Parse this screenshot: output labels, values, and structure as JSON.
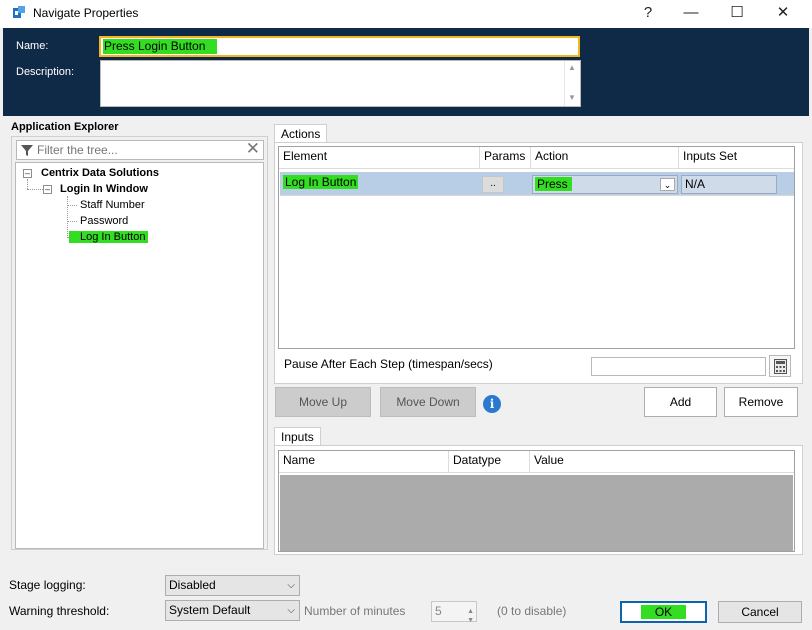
{
  "window": {
    "title": "Navigate Properties",
    "help_glyph": "?",
    "minimize_glyph": "—",
    "maximize_glyph": "☐",
    "close_glyph": "✕"
  },
  "header": {
    "name_label": "Name:",
    "name_value": "Press Login Button",
    "description_label": "Description:",
    "description_value": ""
  },
  "explorer": {
    "title": "Application Explorer",
    "filter_placeholder": "Filter the tree...",
    "tree": {
      "root": "Centrix Data Solutions",
      "window": "Login In Window",
      "items": [
        "Staff Number",
        "Password",
        "Log In Button"
      ]
    }
  },
  "actions": {
    "tab_label": "Actions",
    "columns": [
      "Element",
      "Params",
      "Action",
      "Inputs Set"
    ],
    "rows": [
      {
        "element": "Log In Button",
        "params": "..",
        "action": "Press",
        "inputs_set": "N/A"
      }
    ],
    "pause_label": "Pause After Each Step (timespan/secs)",
    "pause_value": "",
    "buttons": {
      "move_up": "Move Up",
      "move_down": "Move Down",
      "add": "Add",
      "remove": "Remove"
    }
  },
  "inputs": {
    "tab_label": "Inputs",
    "columns": [
      "Name",
      "Datatype",
      "Value"
    ]
  },
  "footer": {
    "stage_logging_label": "Stage logging:",
    "stage_logging_value": "Disabled",
    "warning_label": "Warning threshold:",
    "warning_value": "System Default",
    "minutes_label": "Number of minutes",
    "minutes_value": "5",
    "zero_hint": "(0 to disable)",
    "ok": "OK",
    "cancel": "Cancel"
  },
  "colors": {
    "header_bg": "#0f2a47",
    "highlight": "#33dd22",
    "selected_row": "#b8cde6",
    "focus_border": "#f1b61f",
    "ok_border": "#0a64ad"
  }
}
